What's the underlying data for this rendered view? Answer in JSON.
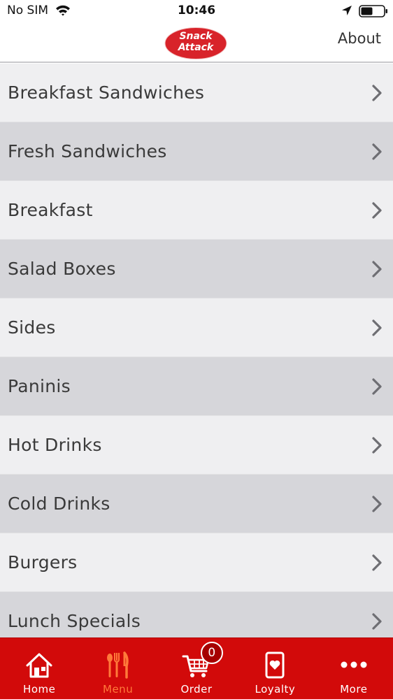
{
  "status_bar": {
    "carrier": "No SIM",
    "time": "10:46"
  },
  "header": {
    "logo_line1": "Snack",
    "logo_line2": "Attack",
    "about_label": "About"
  },
  "menu": {
    "items": [
      {
        "label": "Breakfast Sandwiches"
      },
      {
        "label": "Fresh Sandwiches"
      },
      {
        "label": "Breakfast"
      },
      {
        "label": "Salad Boxes"
      },
      {
        "label": "Sides"
      },
      {
        "label": "Paninis"
      },
      {
        "label": "Hot Drinks"
      },
      {
        "label": "Cold Drinks"
      },
      {
        "label": "Burgers"
      },
      {
        "label": "Lunch Specials"
      }
    ]
  },
  "tab_bar": {
    "tabs": [
      {
        "label": "Home",
        "icon": "home-icon"
      },
      {
        "label": "Menu",
        "icon": "cutlery-icon",
        "active": true
      },
      {
        "label": "Order",
        "icon": "cart-icon"
      },
      {
        "label": "Loyalty",
        "icon": "loyalty-card-icon"
      },
      {
        "label": "More",
        "icon": "more-icon"
      }
    ],
    "cart_count": "0"
  },
  "colors": {
    "brand_red": "#d20a0a",
    "active_tab": "#ff7a3a",
    "row_light": "#efeff1",
    "row_dark": "#d6d6da"
  }
}
